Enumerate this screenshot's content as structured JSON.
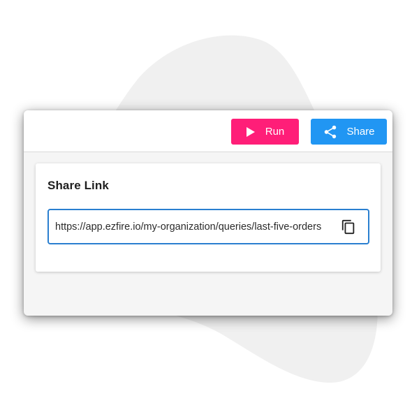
{
  "toolbar": {
    "run_label": "Run",
    "share_label": "Share",
    "run_icon": "play-icon",
    "share_icon": "share-icon"
  },
  "share_card": {
    "title": "Share Link",
    "link_value": "https://app.ezfire.io/my-organization/queries/last-five-orders",
    "copy_icon": "copy-icon"
  },
  "colors": {
    "run_button": "#ff1e78",
    "share_button": "#2196f3",
    "field_border": "#2a7fd0",
    "window_background": "#f5f5f5",
    "backdrop_blob": "#f0f0f0"
  }
}
